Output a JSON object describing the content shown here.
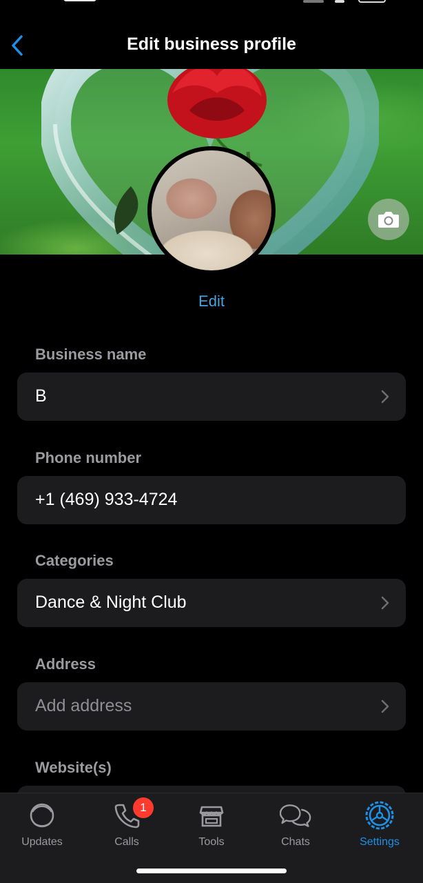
{
  "header": {
    "title": "Edit business profile"
  },
  "profile": {
    "edit_label": "Edit"
  },
  "fields": [
    {
      "label": "Business name",
      "value": "B",
      "placeholder": "",
      "has_chevron": true
    },
    {
      "label": "Phone number",
      "value": "+1 (469) 933-4724",
      "placeholder": "",
      "has_chevron": false
    },
    {
      "label": "Categories",
      "value": "Dance & Night Club",
      "placeholder": "",
      "has_chevron": true
    },
    {
      "label": "Address",
      "value": "",
      "placeholder": "Add address",
      "has_chevron": true
    },
    {
      "label": "Website(s)",
      "value": "",
      "placeholder": "",
      "has_chevron": false
    }
  ],
  "tabs": [
    {
      "label": "Updates",
      "icon": "updates-icon"
    },
    {
      "label": "Calls",
      "icon": "phone-icon",
      "badge": "1"
    },
    {
      "label": "Tools",
      "icon": "storefront-icon"
    },
    {
      "label": "Chats",
      "icon": "chat-bubbles-icon"
    },
    {
      "label": "Settings",
      "icon": "gear-icon",
      "active": true
    }
  ],
  "colors": {
    "accent": "#1e90e6",
    "link": "#4aa3df",
    "card": "#1c1c1e",
    "badge": "#ff3b30"
  }
}
